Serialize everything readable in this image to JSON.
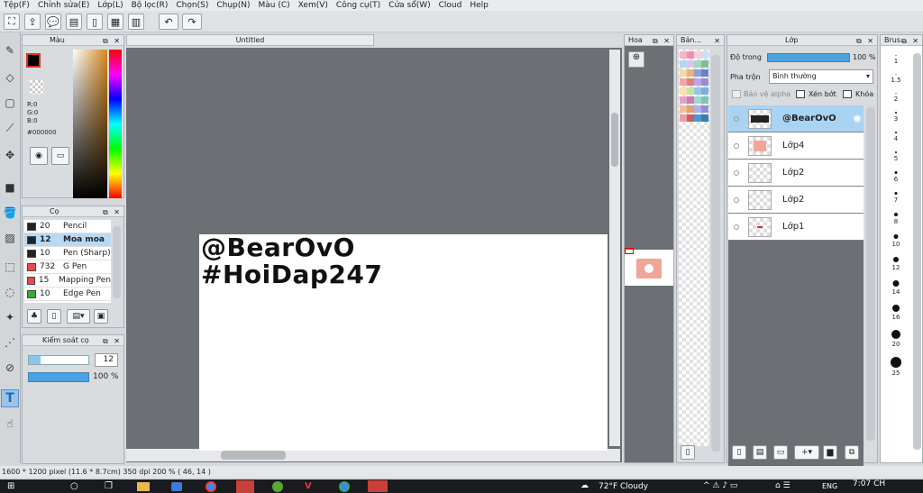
{
  "menu": [
    "Tệp(F)",
    "Chỉnh sửa(E)",
    "Lớp(L)",
    "Bộ lọc(R)",
    "Chọn(S)",
    "Chụp(N)",
    "Màu (C)",
    "Xem(V)",
    "Công cụ(T)",
    "Cửa sổ(W)",
    "Cloud",
    "Help"
  ],
  "canvas": {
    "tab_title": "Untitled",
    "text_line1": "@BearOvO",
    "text_line2": "#HoiDap247"
  },
  "color_panel": {
    "title": "Màu",
    "r": "R:0",
    "g": "G:0",
    "b": "B:0",
    "hex": "#000000"
  },
  "brush_panel": {
    "title": "Cọ",
    "items": [
      {
        "size": "20",
        "name": "Pencil",
        "color": "#222222"
      },
      {
        "size": "12",
        "name": "Moa moa",
        "color": "#222222"
      },
      {
        "size": "10",
        "name": "Pen (Sharp)",
        "color": "#222222"
      },
      {
        "size": "732",
        "name": "G Pen",
        "color": "#e84a4a"
      },
      {
        "size": "15",
        "name": "Mapping Pen",
        "color": "#e84a4a"
      },
      {
        "size": "10",
        "name": "Edge Pen",
        "color": "#3aa83a"
      }
    ]
  },
  "brush_control": {
    "title": "Kiểm soát cọ",
    "size_value": "12",
    "opacity_value": "100 %"
  },
  "nav_panel": {
    "title": "Hoa"
  },
  "palette_panel": {
    "title": "Bản..."
  },
  "layer_panel": {
    "title": "Lớp",
    "opacity_label": "Độ trong",
    "opacity_value": "100 %",
    "blend_label": "Pha trộn",
    "blend_value": "Bình thường",
    "protect_alpha": "Bảo vệ alpha",
    "clipping": "Xén bớt",
    "lock": "Khóa",
    "layers": [
      "@BearOvO",
      "Lớp4",
      "Lớp2",
      "Lớp2",
      "Lớp1"
    ]
  },
  "brush_sizes_panel": {
    "title": "Brus...",
    "labels": [
      "1",
      "1.5",
      "2",
      "3",
      "4",
      "5",
      "6",
      "7",
      "8",
      "10",
      "12",
      "14",
      "16",
      "20",
      "25"
    ]
  },
  "status": {
    "text": "1600 * 1200 pixel  (11.6 * 8.7cm)  350 dpi  200 %  ( 46, 14 )"
  },
  "taskbar": {
    "weather": "72°F  Cloudy",
    "lang": "ENG",
    "time": "7:07 CH"
  },
  "colors": {
    "accent": "#4aa3e0",
    "canvas_bg": "#6c7075"
  }
}
